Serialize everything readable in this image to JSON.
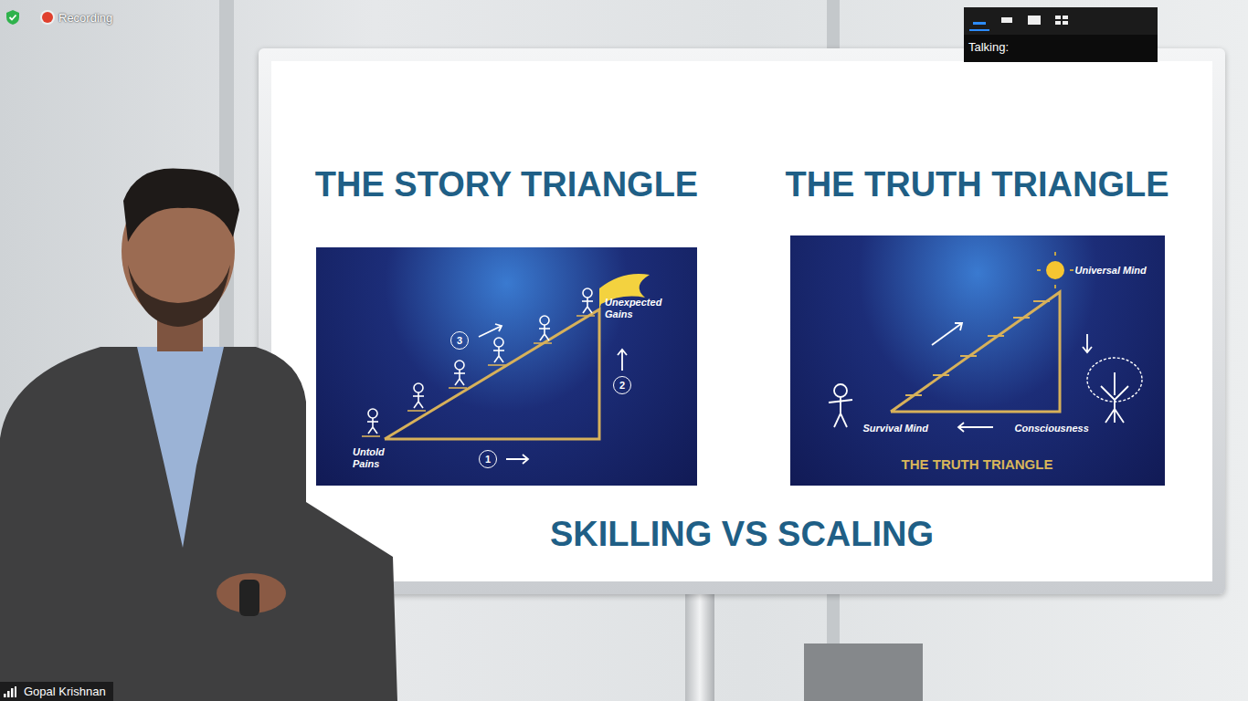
{
  "call": {
    "secure": true,
    "recording_label": "Recording",
    "recording": true,
    "participant_name": "Gopal Krishnan"
  },
  "talking_panel": {
    "label": "Talking:",
    "view_buttons": [
      {
        "selected": true
      },
      {
        "selected": false
      },
      {
        "selected": false
      },
      {
        "selected": false
      }
    ]
  },
  "slide": {
    "panels": [
      {
        "kind": "story",
        "title": "THE STORY TRIANGLE",
        "labels": {
          "top": "Unexpected Gains",
          "bottom": "Untold Pains",
          "steps": [
            "1",
            "2",
            "3"
          ]
        }
      },
      {
        "kind": "truth",
        "title": "THE TRUTH TRIANGLE",
        "labels": {
          "top": "Universal Mind",
          "left": "Survival Mind",
          "right": "Consciousness",
          "caption": "THE TRUTH TRIANGLE"
        }
      }
    ],
    "footer": "SKILLING VS SCALING"
  }
}
